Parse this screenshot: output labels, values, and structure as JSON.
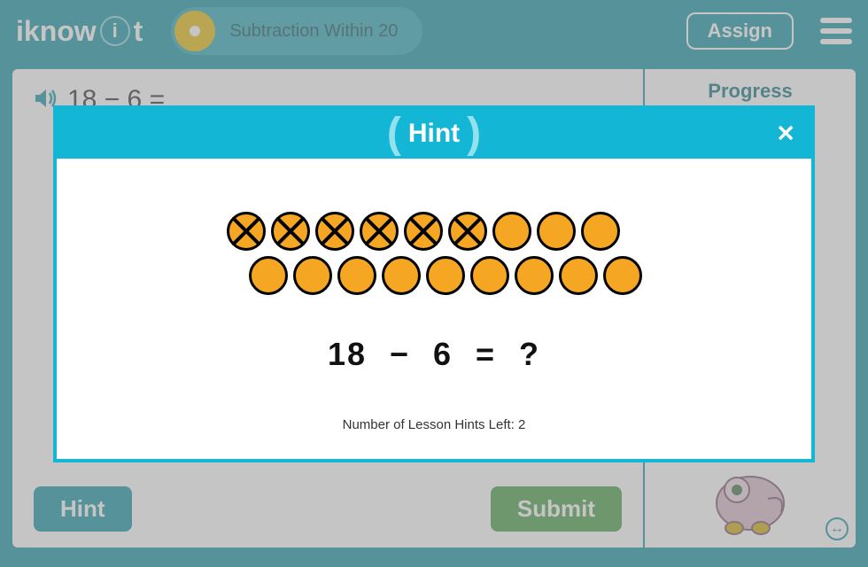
{
  "header": {
    "logo_prefix": "iknow",
    "logo_bulb_text": "i",
    "logo_suffix": "t",
    "lesson_title": "Subtraction Within 20",
    "assign_label": "Assign"
  },
  "question": {
    "text": "18 − 6 =",
    "answer_value": ""
  },
  "buttons": {
    "hint_label": "Hint",
    "submit_label": "Submit"
  },
  "sidebar": {
    "progress_label": "Progress"
  },
  "modal": {
    "title": "Hint",
    "row1_circles": [
      {
        "crossed": true
      },
      {
        "crossed": true
      },
      {
        "crossed": true
      },
      {
        "crossed": true
      },
      {
        "crossed": true
      },
      {
        "crossed": true
      },
      {
        "crossed": false
      },
      {
        "crossed": false
      },
      {
        "crossed": false
      }
    ],
    "row2_circles": [
      {
        "crossed": false
      },
      {
        "crossed": false
      },
      {
        "crossed": false
      },
      {
        "crossed": false
      },
      {
        "crossed": false
      },
      {
        "crossed": false
      },
      {
        "crossed": false
      },
      {
        "crossed": false
      },
      {
        "crossed": false
      }
    ],
    "equation": "18 − 6 = ?",
    "hints_left_text": "Number of Lesson Hints Left: 2",
    "close_glyph": "✕"
  }
}
